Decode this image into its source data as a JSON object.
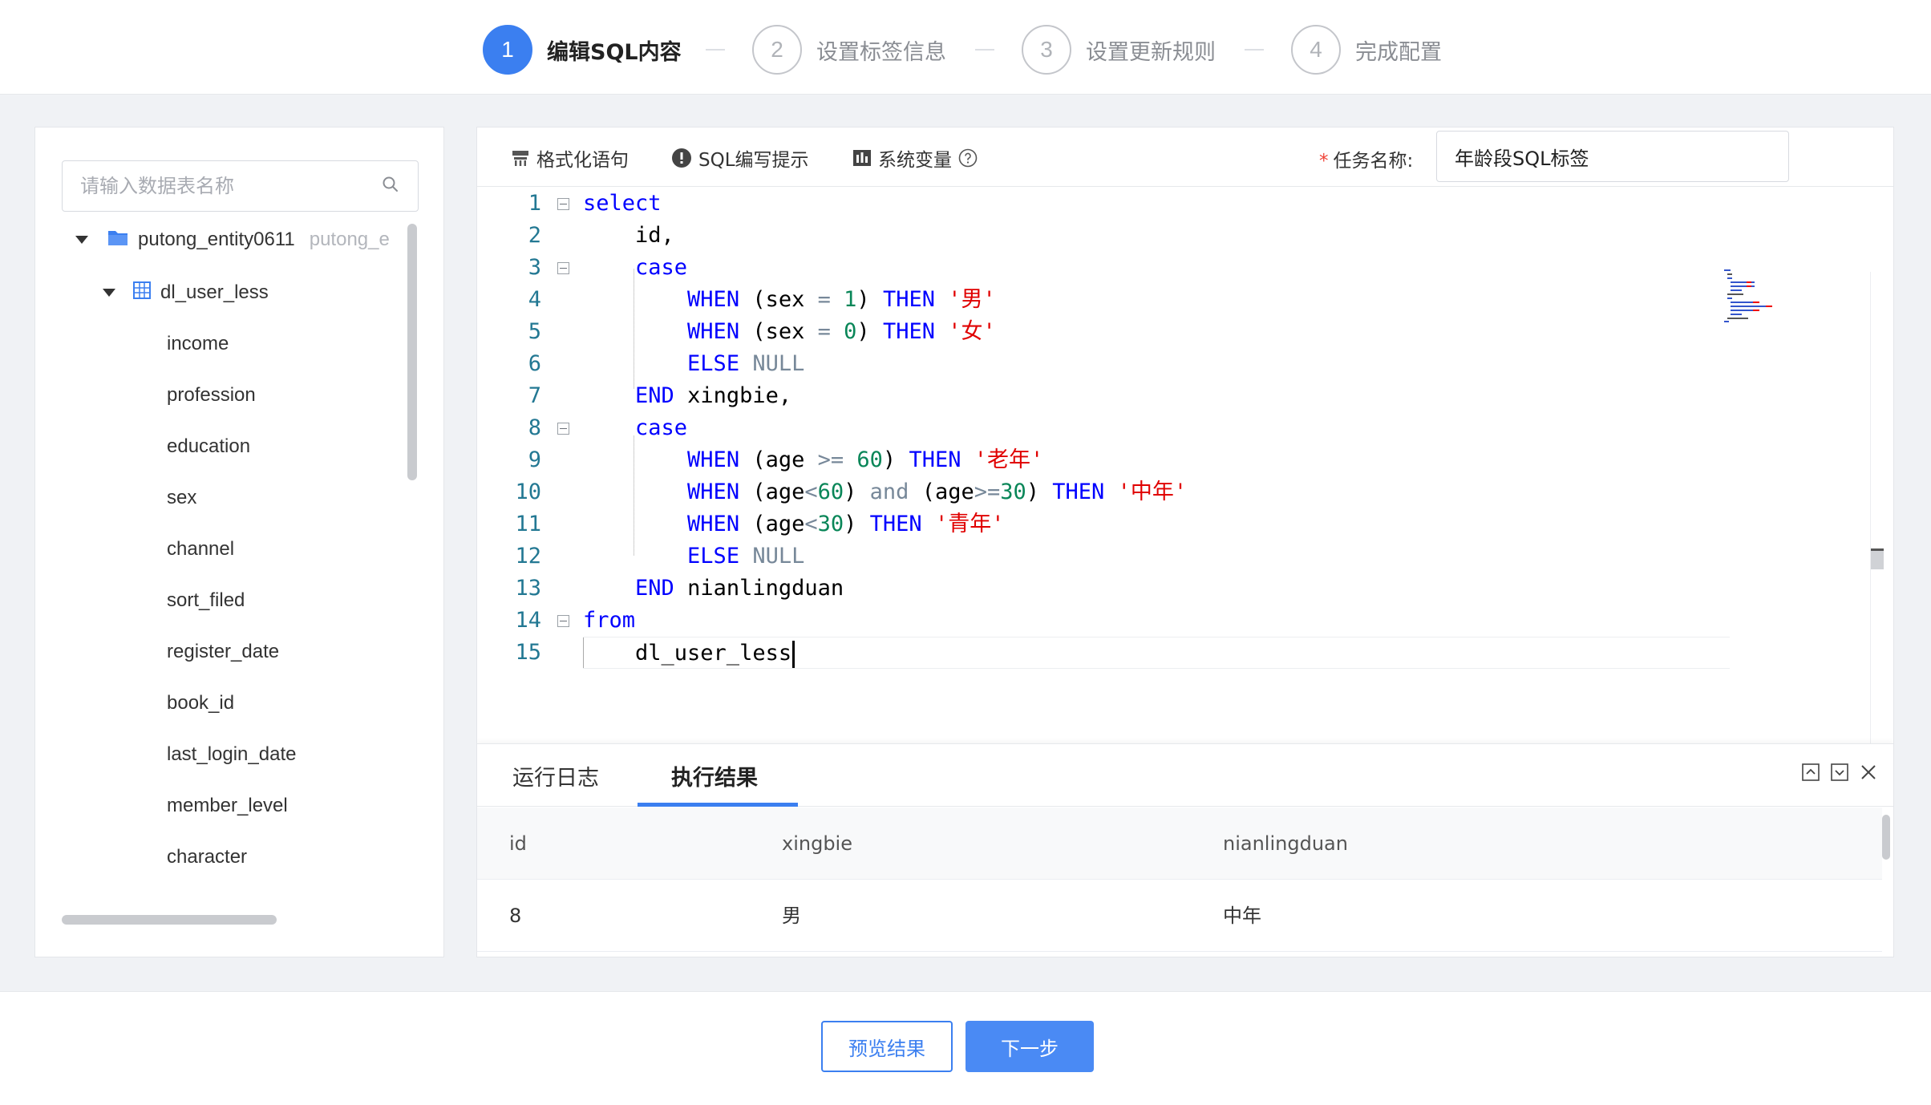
{
  "steps": [
    {
      "number": "1",
      "label": "编辑SQL内容"
    },
    {
      "number": "2",
      "label": "设置标签信息"
    },
    {
      "number": "3",
      "label": "设置更新规则"
    },
    {
      "number": "4",
      "label": "完成配置"
    }
  ],
  "sidebar": {
    "search_placeholder": "请输入数据表名称",
    "database": {
      "name": "putong_entity0611",
      "alias": "putong_e"
    },
    "table": "dl_user_less",
    "columns": [
      "income",
      "profession",
      "education",
      "sex",
      "channel",
      "sort_filed",
      "register_date",
      "book_id",
      "last_login_date",
      "member_level",
      "character"
    ]
  },
  "toolbar": {
    "format_label": "格式化语句",
    "hint_label": "SQL编写提示",
    "variables_label": "系统变量",
    "task_name_label": "任务名称:",
    "task_name_value": "年龄段SQL标签"
  },
  "editor": {
    "line_numbers": [
      "1",
      "2",
      "3",
      "4",
      "5",
      "6",
      "7",
      "8",
      "9",
      "10",
      "11",
      "12",
      "13",
      "14",
      "15"
    ]
  },
  "results": {
    "tabs": [
      "运行日志",
      "执行结果"
    ],
    "active_tab": "执行结果",
    "columns": [
      "id",
      "xingbie",
      "nianlingduan"
    ],
    "rows": [
      [
        "8",
        "男",
        "中年"
      ]
    ]
  },
  "footer": {
    "preview_label": "预览结果",
    "next_label": "下一步"
  },
  "colors": {
    "primary": "#3b7ff0",
    "keyword": "#0000ff",
    "string": "#e00000",
    "number": "#098658"
  }
}
